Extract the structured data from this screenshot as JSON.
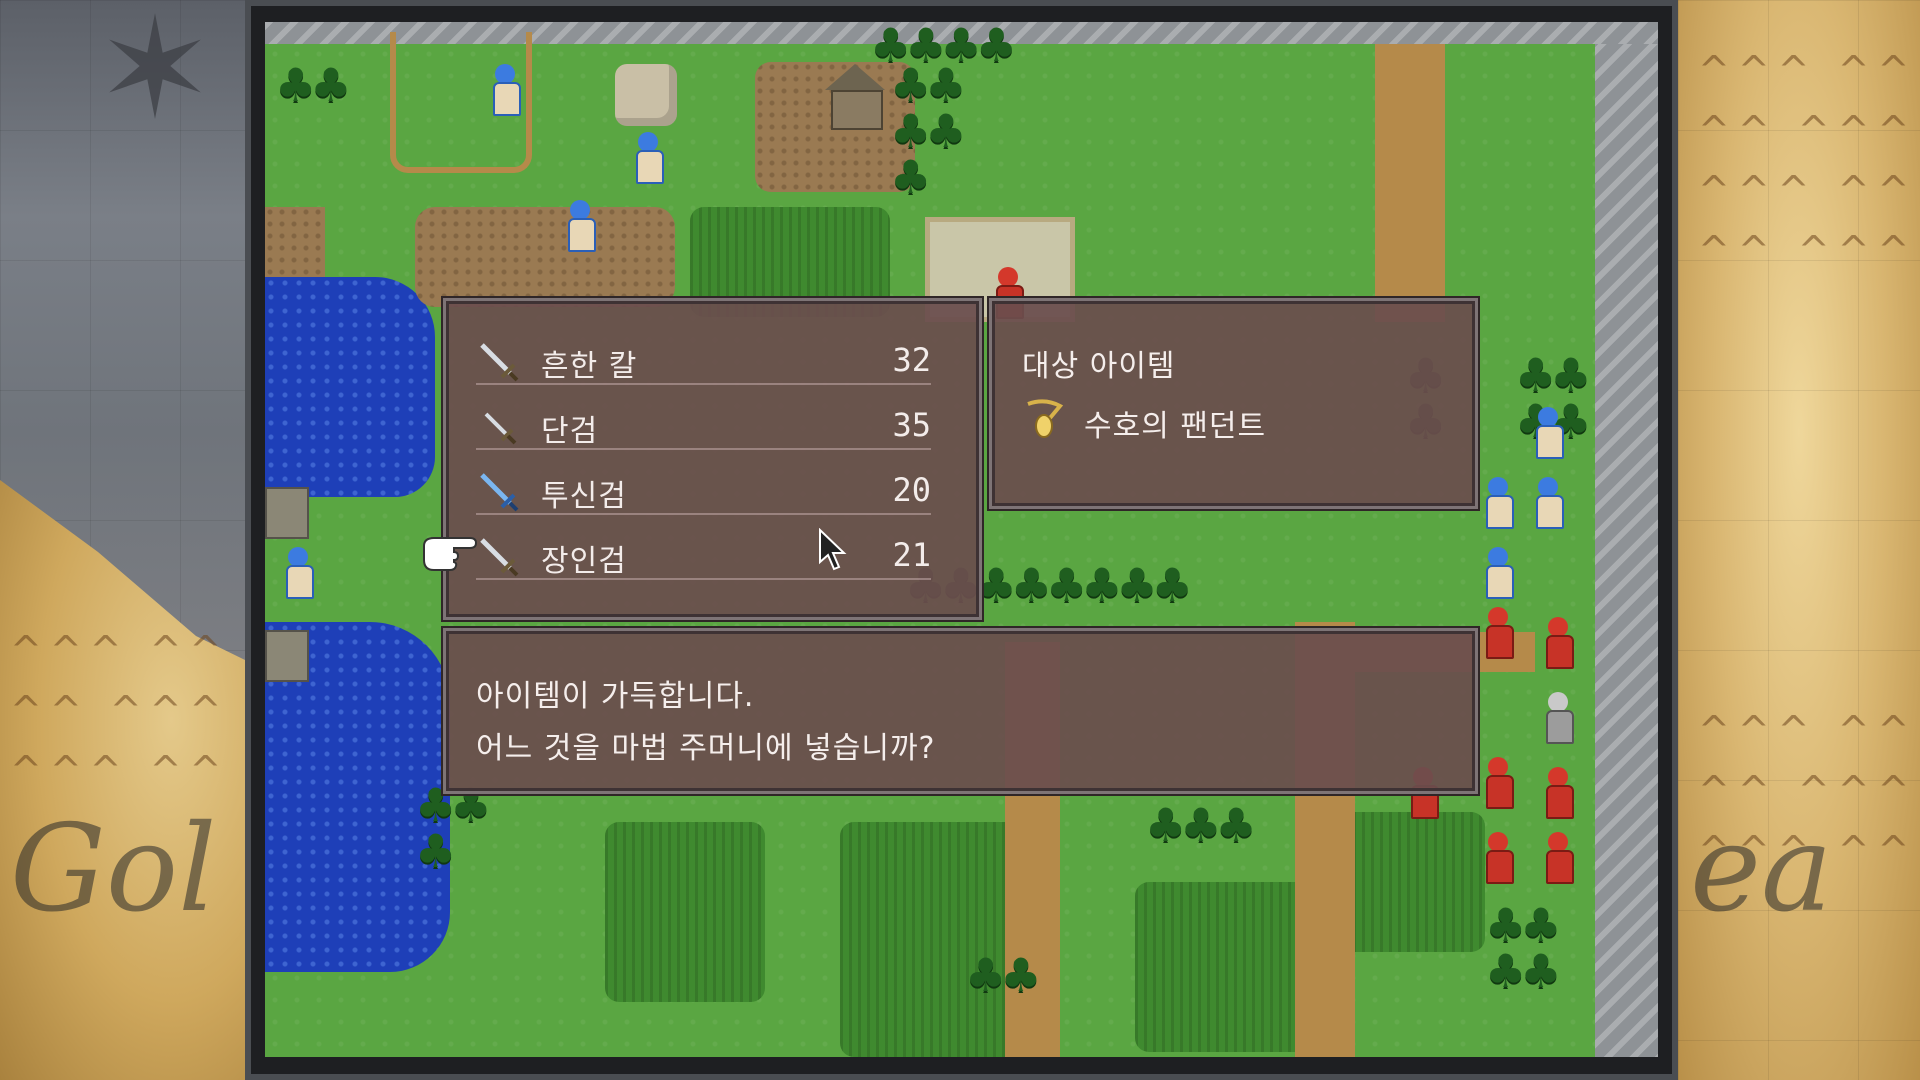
{
  "colors": {
    "window_bg": "#6a4e4e",
    "window_border": "#7e7476",
    "text": "#f3ecea",
    "grass": "#5aa642",
    "water": "#1e3fb8"
  },
  "weapon_list": {
    "items": [
      {
        "icon": "sword-icon",
        "name": "흔한 칼",
        "uses": "32"
      },
      {
        "icon": "dagger-icon",
        "name": "단검",
        "uses": "35"
      },
      {
        "icon": "blue-sword-icon",
        "name": "투신검",
        "uses": "20"
      },
      {
        "icon": "sword-icon",
        "name": "장인검",
        "uses": "21"
      }
    ],
    "selected_index": 3
  },
  "target_panel": {
    "title": "대상 아이템",
    "item_icon": "pendant-icon",
    "item_name": "수호의 팬던트"
  },
  "message": {
    "line1": "아이템이 가득합니다.",
    "line2": "어느 것을 마법 주머니에 넣습니까?"
  },
  "background_art": {
    "left_text": "Gol",
    "right_text": "ea"
  }
}
